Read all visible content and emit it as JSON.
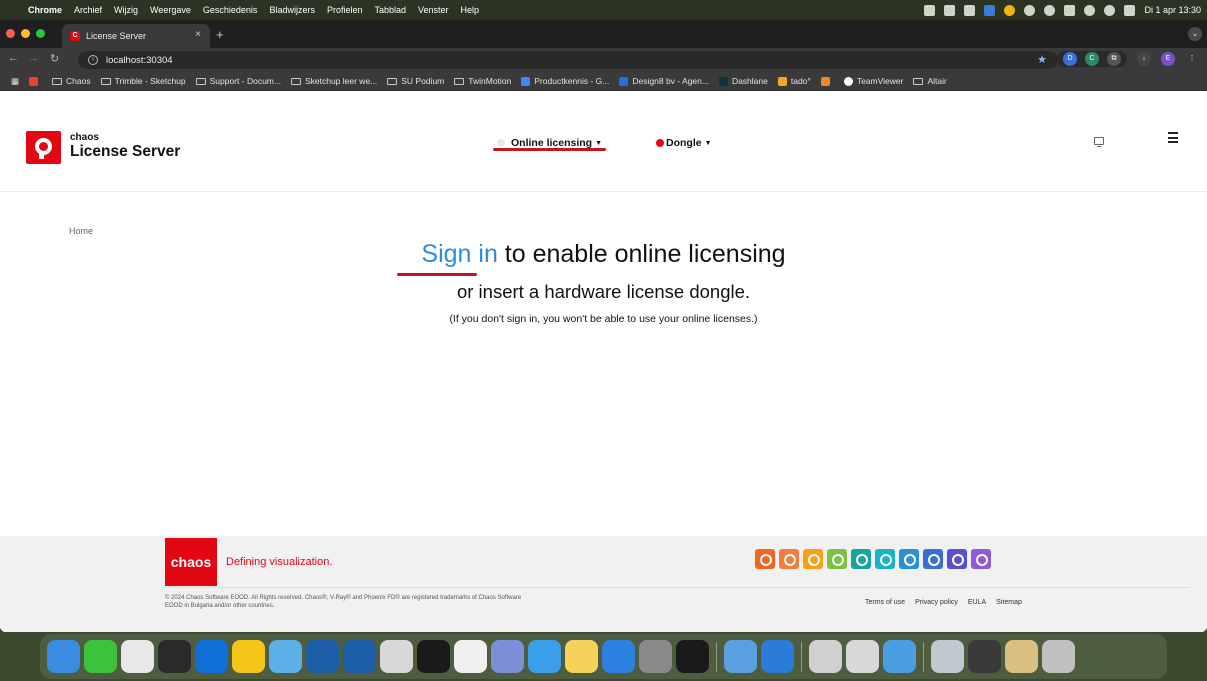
{
  "menubar": {
    "app": "Chrome",
    "items": [
      "Archief",
      "Wijzig",
      "Weergave",
      "Geschiedenis",
      "Bladwijzers",
      "Profielen",
      "Tabblad",
      "Venster",
      "Help"
    ],
    "clock": "Di 1 apr  13:30"
  },
  "browser": {
    "tab_title": "License Server",
    "url": "localhost:30304",
    "bookmarks": [
      "Chaos",
      "Trimble - Sketchup",
      "Support - Docum...",
      "Sketchup leer we...",
      "SU Podium",
      "TwinMotion",
      "Productkennis - G...",
      "Design8 bv - Agen...",
      "Dashlane",
      "tado°",
      "TeamViewer",
      "Altair"
    ]
  },
  "header": {
    "logo_small": "chaos",
    "logo_title": "License Server",
    "nav_online": "Online licensing",
    "nav_dongle": "Dongle"
  },
  "main": {
    "breadcrumb": "Home",
    "signin_link": "Sign in",
    "headline_rest": " to enable online licensing",
    "subheadline": "or insert a hardware license dongle.",
    "note": "(If you don't sign in, you won't be able to use your online licenses.)"
  },
  "footer": {
    "logo": "chaos",
    "tagline": "Defining visualization.",
    "copyright": "© 2024 Chaos Software EOOD. All Rights reserved. Chaos®, V-Ray® and Phoenix FD® are registered trademarks of Chaos Software EOOD in Bulgaria and/or other countries.",
    "links": [
      "Terms of use",
      "Privacy policy",
      "EULA",
      "Sitemap"
    ],
    "product_colors": [
      "#f26522",
      "#f47c3c",
      "#f9a01b",
      "#7cc242",
      "#1aa39a",
      "#19b3c9",
      "#2a8fd4",
      "#3b6fd6",
      "#5a4fcf",
      "#8e5bd6"
    ]
  },
  "colors": {
    "brand_red": "#e30613",
    "link_blue": "#2b8ce0"
  },
  "dock": {
    "apps": [
      "Finder",
      "Messages",
      "Chrome",
      "Feedly",
      "TeamViewer",
      "Google Drive",
      "Folder",
      "SketchUp",
      "SketchUp",
      "Unreal",
      "Epic Games",
      "SketchBook",
      "Launchpad",
      "Safari",
      "Notes",
      "App Store",
      "System Settings",
      "Terminal",
      "Preview",
      "Dashlane",
      "Documents",
      "Screenshot",
      "Alert",
      "Window",
      "Window",
      "Window",
      "Trash"
    ],
    "colors": [
      "#3b8be0",
      "#3cc33c",
      "#e8e8e8",
      "#2a2a2a",
      "#0e6fd6",
      "#f5c518",
      "#5bb0e8",
      "#1c5da8",
      "#1c5da8",
      "#d8d8d8",
      "#1a1a1a",
      "#f0f0f0",
      "#7a8fd8",
      "#3a9fe8",
      "#f5d25a",
      "#2d7fe0",
      "#8a8a8a",
      "#1a1a1a",
      "#5aa0e0",
      "#2a7cd8",
      "#d0d0d0",
      "#d8d8d8",
      "#4a9fe0",
      "#c0c8d0",
      "#3a3a3a",
      "#d9c080",
      "#c0c0c0"
    ]
  }
}
